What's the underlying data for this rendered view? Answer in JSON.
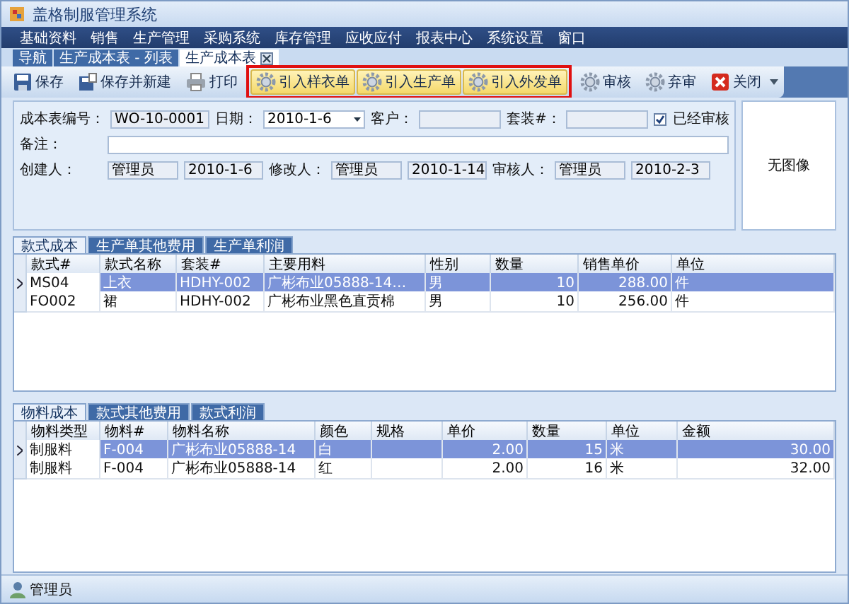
{
  "window": {
    "title": "盖格制服管理系统"
  },
  "menu": [
    "基础资料",
    "销售",
    "生产管理",
    "采购系统",
    "库存管理",
    "应收应付",
    "报表中心",
    "系统设置",
    "窗口"
  ],
  "doc_tabs": [
    {
      "label": "导航",
      "selected": false,
      "closable": false
    },
    {
      "label": "生产成本表 - 列表",
      "selected": false,
      "closable": false
    },
    {
      "label": "生产成本表",
      "selected": true,
      "closable": true
    }
  ],
  "toolbar": [
    {
      "label": "保存",
      "kind": "save",
      "framed": false
    },
    {
      "label": "保存并新建",
      "kind": "savenew",
      "framed": false
    },
    {
      "label": "打印",
      "kind": "print",
      "framed": false
    },
    {
      "label": "引入样衣单",
      "kind": "gear",
      "framed": true
    },
    {
      "label": "引入生产单",
      "kind": "gear",
      "framed": true
    },
    {
      "label": "引入外发单",
      "kind": "gear",
      "framed": true
    },
    {
      "label": "审核",
      "kind": "gear",
      "framed": false
    },
    {
      "label": "弃审",
      "kind": "gear",
      "framed": false
    },
    {
      "label": "关闭",
      "kind": "close",
      "framed": false
    }
  ],
  "form": {
    "header_fields": [
      {
        "label": "成本表编号：",
        "kind": "text",
        "readonly": true,
        "value": "WO-10-0001"
      },
      {
        "label": "日期：",
        "kind": "date",
        "readonly": false,
        "value": "2010-1-6"
      },
      {
        "label": "客户：",
        "kind": "text",
        "readonly": true
      },
      {
        "label": "套装#：",
        "kind": "text",
        "readonly": true
      }
    ],
    "audited": {
      "label": "已经审核",
      "checked": true
    },
    "remark": {
      "label": "备注：",
      "readonly": false
    },
    "people": [
      {
        "label": "创建人：",
        "name": "管理员",
        "date": "2010-1-6"
      },
      {
        "label": "修改人：",
        "name": "管理员",
        "date": "2010-1-14"
      },
      {
        "label": "审核人：",
        "name": "管理员",
        "date": "2010-2-3"
      }
    ],
    "image_text": "无图像"
  },
  "style_tabs": [
    {
      "label": "款式成本",
      "selected": true
    },
    {
      "label": "生产单其他费用",
      "selected": false
    },
    {
      "label": "生产单利润",
      "selected": false
    }
  ],
  "style_table": {
    "columns": [
      {
        "label": "款式#",
        "numeric": false
      },
      {
        "label": "款式名称",
        "numeric": false
      },
      {
        "label": "套装#",
        "numeric": false
      },
      {
        "label": "主要用料",
        "numeric": false
      },
      {
        "label": "性别",
        "numeric": false
      },
      {
        "label": "数量",
        "numeric": true
      },
      {
        "label": "销售单价",
        "numeric": true
      },
      {
        "label": "单位",
        "numeric": false
      }
    ],
    "rows": [
      {
        "selected": true,
        "cells": [
          "MS04",
          "上衣",
          "HDHY-002",
          "广彬布业05888-14…",
          "男",
          "10",
          "288.00",
          "件"
        ]
      },
      {
        "selected": false,
        "cells": [
          "FO002",
          "裙",
          "HDHY-002",
          "广彬布业黑色直贡棉",
          "男",
          "10",
          "256.00",
          "件"
        ]
      }
    ]
  },
  "material_tabs": [
    {
      "label": "物料成本",
      "selected": true
    },
    {
      "label": "款式其他费用",
      "selected": false
    },
    {
      "label": "款式利润",
      "selected": false
    }
  ],
  "material_table": {
    "columns": [
      {
        "label": "物料类型",
        "numeric": false
      },
      {
        "label": "物料#",
        "numeric": false
      },
      {
        "label": "物料名称",
        "numeric": false
      },
      {
        "label": "颜色",
        "numeric": false
      },
      {
        "label": "规格",
        "numeric": false
      },
      {
        "label": "单价",
        "numeric": true
      },
      {
        "label": "数量",
        "numeric": true
      },
      {
        "label": "单位",
        "numeric": false
      },
      {
        "label": "金额",
        "numeric": true
      }
    ],
    "rows": [
      {
        "selected": true,
        "cells": [
          "制服料",
          "F-004",
          "广彬布业05888-14",
          "白",
          "",
          "2.00",
          "15",
          "米",
          "30.00"
        ]
      },
      {
        "selected": false,
        "cells": [
          "制服料",
          "F-004",
          "广彬布业05888-14",
          "红",
          "",
          "2.00",
          "16",
          "米",
          "32.00"
        ]
      }
    ]
  },
  "status_bar": {
    "user": "管理员"
  }
}
